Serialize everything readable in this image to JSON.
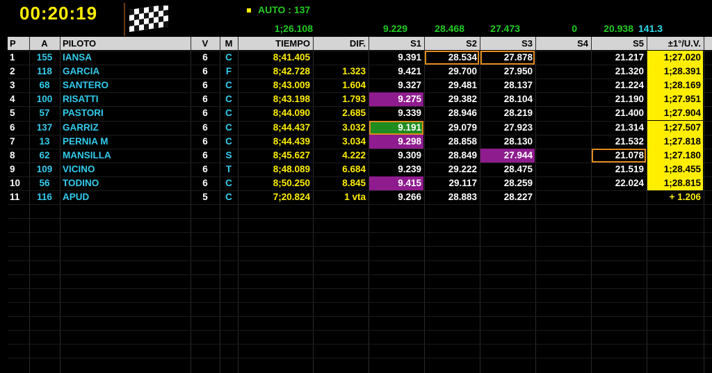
{
  "clock": "00:20:19",
  "auto_label": "AUTO : 137",
  "summary": {
    "best_lap": "1;26.108",
    "s1": "9.229",
    "s2": "28.468",
    "s3": "27.473",
    "s4": "0",
    "s5": "20.938",
    "speed": "141.3"
  },
  "headers": {
    "p": "P",
    "a": "A",
    "piloto": "PILOTO",
    "v": "V",
    "m": "M",
    "tiempo": "TIEMPO",
    "dif": "DIF.",
    "s1": "S1",
    "s2": "S2",
    "s3": "S3",
    "s4": "S4",
    "s5": "S5",
    "last": "±1°/U.V."
  },
  "rows": [
    {
      "p": "1",
      "a": "155",
      "piloto": "IANSA",
      "v": "6",
      "m": "C",
      "tiempo": "8;41.405",
      "dif": "",
      "s1": "9.391",
      "s2": "28.534",
      "s3": "27.878",
      "s4": "",
      "s5": "21.217",
      "last": "1;27.020"
    },
    {
      "p": "2",
      "a": "118",
      "piloto": "GARCIA",
      "v": "6",
      "m": "F",
      "tiempo": "8;42.728",
      "dif": "1.323",
      "s1": "9.421",
      "s2": "29.700",
      "s3": "27.950",
      "s4": "",
      "s5": "21.320",
      "last": "1;28.391"
    },
    {
      "p": "3",
      "a": "68",
      "piloto": "SANTERO",
      "v": "6",
      "m": "C",
      "tiempo": "8;43.009",
      "dif": "1.604",
      "s1": "9.327",
      "s2": "29.481",
      "s3": "28.137",
      "s4": "",
      "s5": "21.224",
      "last": "1;28.169"
    },
    {
      "p": "4",
      "a": "100",
      "piloto": "RISATTI",
      "v": "6",
      "m": "C",
      "tiempo": "8;43.198",
      "dif": "1.793",
      "s1": "9.275",
      "s2": "29.382",
      "s3": "28.104",
      "s4": "",
      "s5": "21.190",
      "last": "1;27.951"
    },
    {
      "p": "5",
      "a": "57",
      "piloto": "PASTORI",
      "v": "6",
      "m": "C",
      "tiempo": "8;44.090",
      "dif": "2.685",
      "s1": "9.339",
      "s2": "28.946",
      "s3": "28.219",
      "s4": "",
      "s5": "21.400",
      "last": "1;27.904"
    },
    {
      "p": "6",
      "a": "137",
      "piloto": "GARRIZ",
      "v": "6",
      "m": "C",
      "tiempo": "8;44.437",
      "dif": "3.032",
      "s1": "9.191",
      "s2": "29.079",
      "s3": "27.923",
      "s4": "",
      "s5": "21.314",
      "last": "1;27.507"
    },
    {
      "p": "7",
      "a": "13",
      "piloto": "PERNIA M",
      "v": "6",
      "m": "C",
      "tiempo": "8;44.439",
      "dif": "3.034",
      "s1": "9.298",
      "s2": "28.858",
      "s3": "28.130",
      "s4": "",
      "s5": "21.532",
      "last": "1;27.818"
    },
    {
      "p": "8",
      "a": "62",
      "piloto": "MANSILLA",
      "v": "6",
      "m": "S",
      "tiempo": "8;45.627",
      "dif": "4.222",
      "s1": "9.309",
      "s2": "28.849",
      "s3": "27.944",
      "s4": "",
      "s5": "21.078",
      "last": "1;27.180"
    },
    {
      "p": "9",
      "a": "109",
      "piloto": "VICINO",
      "v": "6",
      "m": "T",
      "tiempo": "8;48.089",
      "dif": "6.684",
      "s1": "9.239",
      "s2": "29.222",
      "s3": "28.475",
      "s4": "",
      "s5": "21.519",
      "last": "1;28.455"
    },
    {
      "p": "10",
      "a": "56",
      "piloto": "TODINO",
      "v": "6",
      "m": "C",
      "tiempo": "8;50.250",
      "dif": "8.845",
      "s1": "9.415",
      "s2": "29.117",
      "s3": "28.259",
      "s4": "",
      "s5": "22.024",
      "last": "1;28.815"
    },
    {
      "p": "11",
      "a": "116",
      "piloto": "APUD",
      "v": "5",
      "m": "C",
      "tiempo": "7;20.824",
      "dif": "1 vta",
      "s1": "9.266",
      "s2": "28.883",
      "s3": "28.227",
      "s4": "",
      "s5": "",
      "last": "+  1.206"
    }
  ],
  "highlights": {
    "s1_purple": [
      3,
      6,
      9
    ],
    "s1_green": [
      5
    ],
    "s1_orange_box": [
      5
    ],
    "s2_orange_box": [
      0
    ],
    "s3_orange_box": [
      0
    ],
    "s3_purple": [
      7
    ],
    "s5_orange_box": [
      7
    ],
    "last_yellow": [
      0,
      1,
      2,
      3,
      4,
      5,
      6,
      7,
      8,
      9
    ]
  },
  "colors": {
    "background": "#000000",
    "header_bg": "#d4d4d4",
    "clock": "#ffee00",
    "green_text": "#22cc22",
    "cyan_text": "#33ccee",
    "purple_cell": "#8e1c8e",
    "green_cell": "#1f8c1f",
    "orange_box": "#e08a1c",
    "yellow_cell": "#ffee00"
  }
}
